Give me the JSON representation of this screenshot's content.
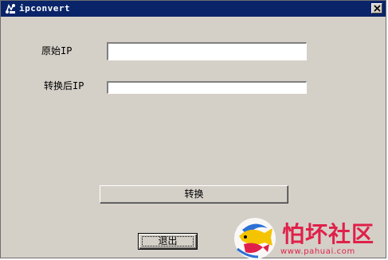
{
  "window": {
    "title": "ipconvert",
    "icon": "app-icon",
    "close_icon": "close-icon"
  },
  "form": {
    "source_ip_label": "原始IP",
    "source_ip_value": "",
    "converted_ip_label": "转换后IP",
    "converted_ip_value": ""
  },
  "buttons": {
    "convert_label": "转换",
    "exit_label": "退出"
  },
  "watermark": {
    "title": "怕坏社区",
    "url": "www.pahuai.com"
  },
  "colors": {
    "titlebar": "#0a246a",
    "window_bg": "#d4d0c8",
    "watermark": "#e0204a"
  }
}
